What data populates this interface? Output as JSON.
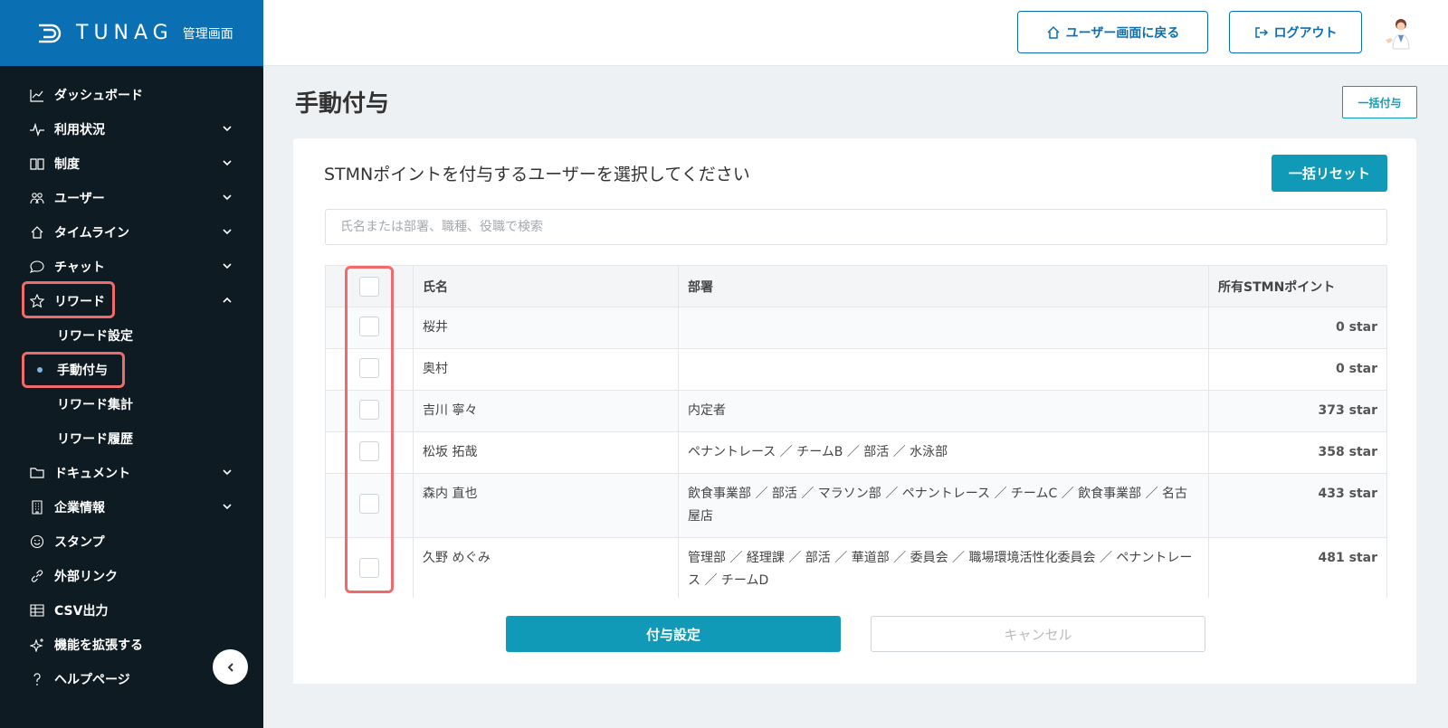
{
  "brand": {
    "name": "TUNAG",
    "sub": "管理画面"
  },
  "header": {
    "back_label": "ユーザー画面に戻る",
    "logout_label": "ログアウト"
  },
  "sidebar": {
    "items": [
      {
        "label": "ダッシュボード",
        "icon": "chart-icon",
        "chevron": ""
      },
      {
        "label": "利用状況",
        "icon": "pulse-icon",
        "chevron": "down"
      },
      {
        "label": "制度",
        "icon": "book-icon",
        "chevron": "down"
      },
      {
        "label": "ユーザー",
        "icon": "users-icon",
        "chevron": "down"
      },
      {
        "label": "タイムライン",
        "icon": "home-icon",
        "chevron": "down"
      },
      {
        "label": "チャット",
        "icon": "chat-icon",
        "chevron": "down"
      },
      {
        "label": "リワード",
        "icon": "star-icon",
        "chevron": "up"
      }
    ],
    "sub_items": [
      {
        "label": "リワード設定"
      },
      {
        "label": "手動付与",
        "active": true
      },
      {
        "label": "リワード集計"
      },
      {
        "label": "リワード履歴"
      }
    ],
    "items_after": [
      {
        "label": "ドキュメント",
        "icon": "folder-icon",
        "chevron": "down"
      },
      {
        "label": "企業情報",
        "icon": "building-icon",
        "chevron": "down"
      },
      {
        "label": "スタンプ",
        "icon": "smile-icon",
        "chevron": ""
      },
      {
        "label": "外部リンク",
        "icon": "link-icon",
        "chevron": ""
      },
      {
        "label": "CSV出力",
        "icon": "table-icon",
        "chevron": ""
      },
      {
        "label": "機能を拡張する",
        "icon": "sparkle-icon",
        "chevron": ""
      },
      {
        "label": "ヘルプページ",
        "icon": "help-icon",
        "chevron": ""
      }
    ]
  },
  "main": {
    "title": "手動付与",
    "bulk_label": "一括付与",
    "card_title": "STMNポイントを付与するユーザーを選択してください",
    "reset_label": "一括リセット",
    "search_placeholder": "氏名または部署、職種、役職で検索",
    "table": {
      "headers": [
        "氏名",
        "部署",
        "所有STMNポイント"
      ],
      "rows": [
        {
          "name": "桜井",
          "dept": "",
          "points": "0 star"
        },
        {
          "name": "奥村",
          "dept": "",
          "points": "0 star"
        },
        {
          "name": "吉川 寧々",
          "dept": "内定者",
          "points": "373 star"
        },
        {
          "name": "松坂 拓哉",
          "dept": "ペナントレース ／ チームB ／ 部活 ／ 水泳部",
          "points": "358 star"
        },
        {
          "name": "森内 直也",
          "dept": "飲食事業部 ／ 部活 ／ マラソン部 ／ ペナントレース ／ チームC ／ 飲食事業部 ／ 名古屋店",
          "points": "433 star"
        },
        {
          "name": "久野 めぐみ",
          "dept": "管理部 ／ 経理課 ／ 部活 ／ 華道部 ／ 委員会 ／ 職場環境活性化委員会 ／ ペナントレース ／ チームD",
          "points": "481 star"
        }
      ]
    },
    "submit_label": "付与設定",
    "cancel_label": "キャンセル"
  },
  "colors": {
    "brand": "#0b6fb3",
    "accent": "#119ab8",
    "sidebar_bg": "#0f1b22",
    "highlight": "#ee6b6b"
  }
}
